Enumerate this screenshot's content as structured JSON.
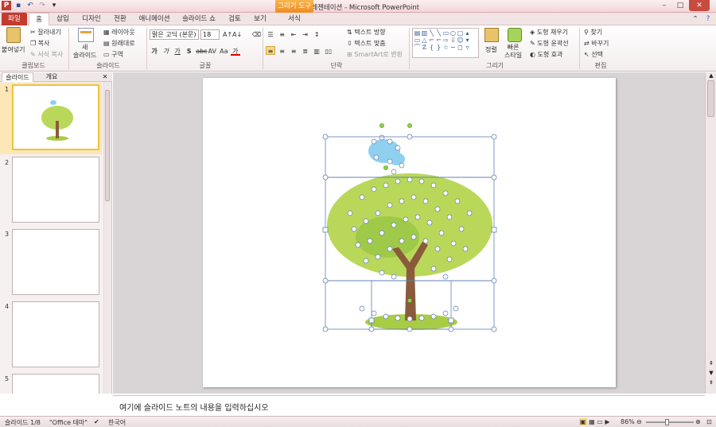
{
  "window": {
    "title": "새 프레젠테이션 - Microsoft PowerPoint",
    "context_tab": "그리기 도구"
  },
  "tabs": [
    "파일",
    "홈",
    "삽입",
    "디자인",
    "전환",
    "애니메이션",
    "슬라이드 쇼",
    "검토",
    "보기",
    "서식"
  ],
  "ribbon": {
    "clipboard": {
      "paste": "붙여넣기",
      "cut": "잘라내기",
      "copy": "복사",
      "format_painter": "서식 복사",
      "label": "클립보드"
    },
    "slides": {
      "new_slide": "새\n슬라이드",
      "layout": "레이아웃",
      "reset": "원래대로",
      "section": "구역",
      "label": "슬라이드"
    },
    "font": {
      "font_name": "맑은 고딕 (본문)",
      "font_size": "18",
      "label": "글꼴"
    },
    "paragraph": {
      "text_direction": "텍스트 방향",
      "align_text": "텍스트 맞춤",
      "smartart": "SmartArt로 변환",
      "label": "단락"
    },
    "drawing": {
      "arrange": "정렬",
      "quick_styles": "빠른\n스타일",
      "shape_fill": "도형 채우기",
      "shape_outline": "도형 윤곽선",
      "shape_effects": "도형 효과",
      "label": "그리기"
    },
    "editing": {
      "find": "찾기",
      "replace": "바꾸기",
      "select": "선택",
      "label": "편집"
    }
  },
  "panel": {
    "tabs": [
      "슬라이드",
      "개요"
    ],
    "slide_numbers": [
      "1",
      "2",
      "3",
      "4",
      "5"
    ]
  },
  "notes": {
    "placeholder": "여기에 슬라이드 노트의 내용을 입력하십시오"
  },
  "status": {
    "slide": "슬라이드 1/8",
    "theme": "\"Office 테마\"",
    "language": "한국어",
    "zoom": "86%"
  },
  "colors": {
    "file_tab": "#c23b2f",
    "context_tab": "#ef8a23",
    "foliage": "#b9d85a",
    "trunk": "#8b5a3c",
    "bird": "#8fd0ef",
    "selection": "#5f7fb5"
  }
}
